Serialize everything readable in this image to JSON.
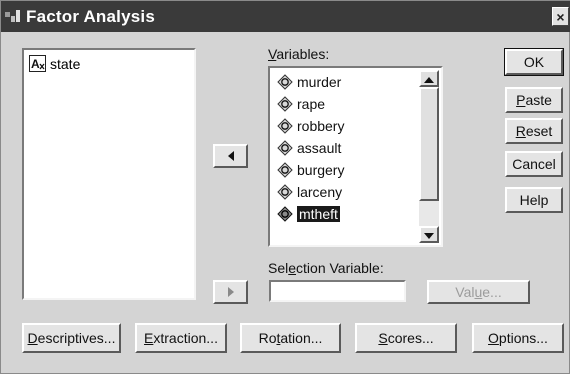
{
  "window": {
    "title": "Factor Analysis",
    "close_glyph": "×"
  },
  "source_list": {
    "items": [
      {
        "label": "state",
        "icon": "string-variable-icon"
      }
    ]
  },
  "variables": {
    "label_prefix": "",
    "label_mnemonic": "V",
    "label_rest": "ariables:",
    "items": [
      {
        "label": "murder",
        "icon": "scale-variable-icon",
        "selected": false
      },
      {
        "label": "rape",
        "icon": "scale-variable-icon",
        "selected": false
      },
      {
        "label": "robbery",
        "icon": "scale-variable-icon",
        "selected": false
      },
      {
        "label": "assault",
        "icon": "scale-variable-icon",
        "selected": false
      },
      {
        "label": "burgery",
        "icon": "scale-variable-icon",
        "selected": false
      },
      {
        "label": "larceny",
        "icon": "scale-variable-icon",
        "selected": false
      },
      {
        "label": "mtheft",
        "icon": "scale-variable-icon",
        "selected": true
      }
    ]
  },
  "selection_variable": {
    "label_prefix": "Sel",
    "label_mnemonic": "e",
    "label_rest": "ction Variable:",
    "value": "",
    "value_button": {
      "pre": "Val",
      "u": "u",
      "post": "e..."
    }
  },
  "side_buttons": {
    "ok": {
      "pre": "",
      "u": "",
      "post": "OK"
    },
    "paste": {
      "pre": "",
      "u": "P",
      "post": "aste"
    },
    "reset": {
      "pre": "",
      "u": "R",
      "post": "eset"
    },
    "cancel": {
      "pre": "",
      "u": "",
      "post": "Cancel"
    },
    "help": {
      "pre": "",
      "u": "",
      "post": "Help"
    }
  },
  "bottom_buttons": {
    "descriptives": {
      "pre": "",
      "u": "D",
      "post": "escriptives..."
    },
    "extraction": {
      "pre": "",
      "u": "E",
      "post": "xtraction..."
    },
    "rotation": {
      "pre": "Ro",
      "u": "t",
      "post": "ation..."
    },
    "scores": {
      "pre": "",
      "u": "S",
      "post": "cores..."
    },
    "options": {
      "pre": "",
      "u": "O",
      "post": "ptions..."
    }
  },
  "colors": {
    "titlebar": "#3a3a3a",
    "dialog": "#d4d4d4",
    "selection": "#1a1a1a"
  }
}
